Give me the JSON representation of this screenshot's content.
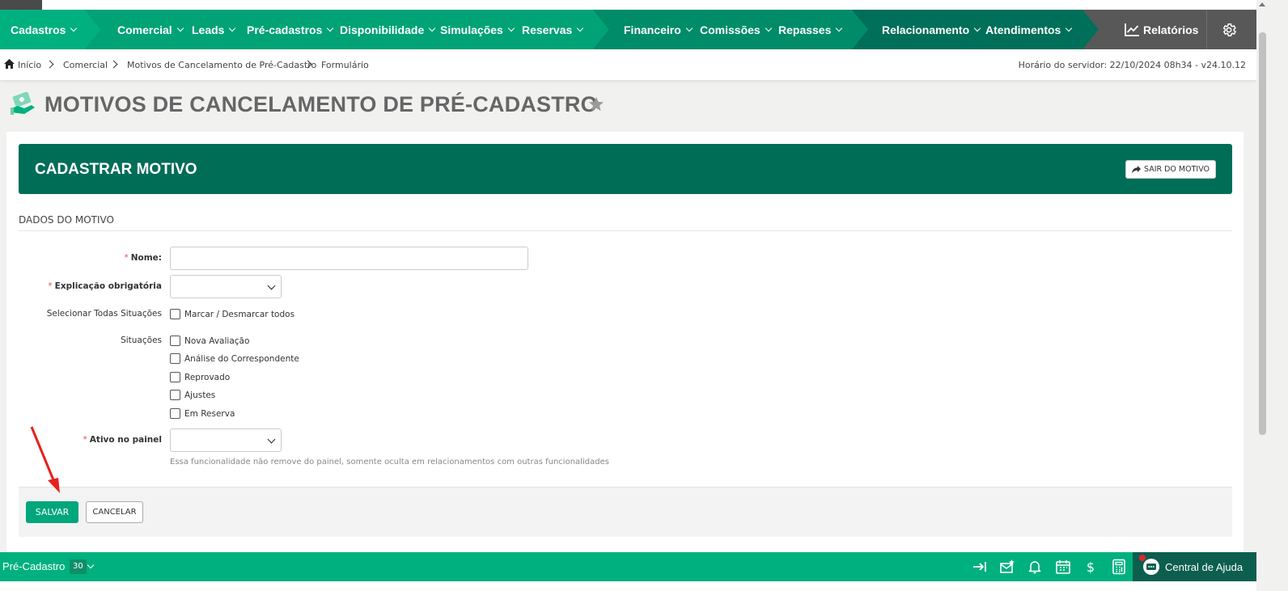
{
  "nav": {
    "items": [
      {
        "label": "Cadastros"
      },
      {
        "label": "Comercial"
      },
      {
        "label": "Leads"
      },
      {
        "label": "Pré-cadastros"
      },
      {
        "label": "Disponibilidade"
      },
      {
        "label": "Simulações"
      },
      {
        "label": "Reservas"
      },
      {
        "label": "Financeiro"
      },
      {
        "label": "Comissões"
      },
      {
        "label": "Repasses"
      },
      {
        "label": "Relacionamento"
      },
      {
        "label": "Atendimentos"
      }
    ],
    "reports_label": "Relatórios",
    "settings_icon": "gear-icon"
  },
  "breadcrumb": {
    "items": [
      "Início",
      "Comercial",
      "Motivos de Cancelamento de Pré-Cadastro",
      "Formulário"
    ],
    "server_time": "Horário do servidor: 22/10/2024 08h34 - v24.10.12"
  },
  "page": {
    "title": "MOTIVOS DE CANCELAMENTO DE PRÉ-CADASTRO"
  },
  "form": {
    "header_title": "CADASTRAR MOTIVO",
    "exit_label": "SAIR DO MOTIVO",
    "section_title": "DADOS DO MOTIVO",
    "required_mark": "*",
    "fields": {
      "nome_label": "Nome:",
      "nome_value": "",
      "explicacao_label": "Explicação obrigatória",
      "explicacao_value": "",
      "select_all_label": "Selecionar Todas Situações",
      "select_all_checkbox": "Marcar / Desmarcar todos",
      "situacoes_label": "Situações",
      "situacoes": [
        {
          "label": "Nova Avaliação",
          "checked": false
        },
        {
          "label": "Análise do Correspondente",
          "checked": false
        },
        {
          "label": "Reprovado",
          "checked": false
        },
        {
          "label": "Ajustes",
          "checked": false
        },
        {
          "label": "Em Reserva",
          "checked": false
        }
      ],
      "ativo_label": "Ativo no painel",
      "ativo_value": "",
      "ativo_help": "Essa funcionalidade não remove do painel, somente oculta em relacionamentos com outras funcionalidades"
    },
    "save_label": "SALVAR",
    "cancel_label": "CANCELAR"
  },
  "bottom_bar": {
    "module_name": "Pré-Cadastro",
    "module_count": "30",
    "help_center": "Central de Ajuda"
  },
  "colors": {
    "primary": "#00b07e",
    "dark_green": "#006d57",
    "annotation": "#e8201b"
  }
}
